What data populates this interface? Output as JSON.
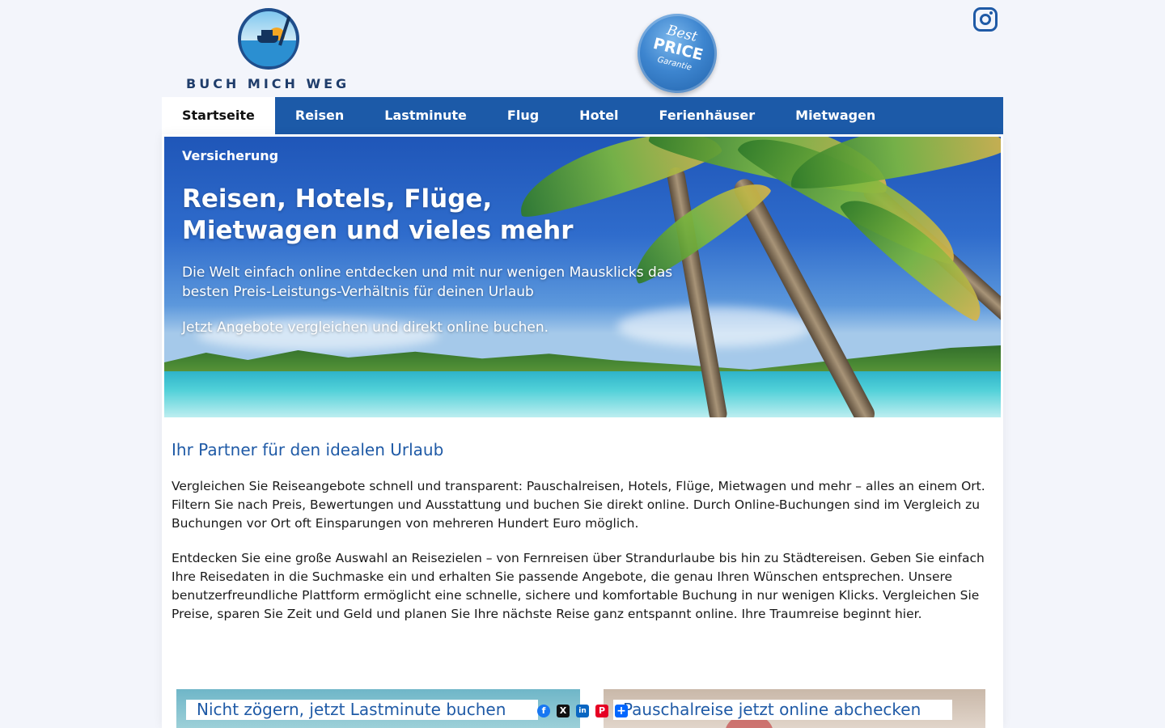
{
  "brand": {
    "logo_text": "BUCH MICH WEG",
    "badge": {
      "line1": "Best",
      "line2": "PRICE",
      "line3": "Garantie"
    },
    "primary_color": "#1c5aa8",
    "link_color": "#1f5aa6"
  },
  "header": {
    "social_icon": "instagram-icon"
  },
  "nav": {
    "items": [
      {
        "label": "Startseite",
        "active": true
      },
      {
        "label": "Reisen"
      },
      {
        "label": "Lastminute"
      },
      {
        "label": "Flug"
      },
      {
        "label": "Hotel"
      },
      {
        "label": "Ferienhäuser"
      },
      {
        "label": "Mietwagen"
      }
    ],
    "overflow_item": "Versicherung"
  },
  "hero": {
    "title": "Reisen, Hotels, Flüge, Mietwagen und vieles mehr",
    "text1": "Die Welt einfach online entdecken und mit nur wenigen Mausklicks das besten Preis-Leistungs-Verhältnis für deinen Urlaub",
    "text2": "Jetzt Angebote vergleichen und direkt online buchen."
  },
  "intro": {
    "title": "Ihr Partner für den idealen Urlaub",
    "p1": "Vergleichen Sie Reiseangebote schnell und transparent: Pauschalreisen, Hotels, Flüge, Mietwagen und mehr – alles an einem Ort. Filtern Sie nach Preis, Bewertungen und Ausstattung und buchen Sie direkt online. Durch Online-Buchungen sind im Vergleich zu Buchungen vor Ort oft Einsparungen von mehreren Hundert Euro möglich.",
    "p2": "Entdecken Sie eine große Auswahl an Reisezielen – von Fernreisen über Strandurlaube bis hin zu Städtereisen. Geben Sie einfach Ihre Reisedaten in die Suchmaske ein und erhalten Sie passende Angebote, die genau Ihren Wünschen entsprechen. Unsere benutzerfreundliche Plattform ermöglicht eine schnelle, sichere und komfortable Buchung in nur wenigen Klicks. Vergleichen Sie Preise, sparen Sie Zeit und Geld und planen Sie Ihre nächste Reise ganz entspannt online. Ihre Traumreise beginnt hier."
  },
  "cards": {
    "left_label": "Nicht zögern, jetzt Lastminute buchen",
    "right_label": "Pauschalreise jetzt online abchecken"
  },
  "share": {
    "buttons": [
      {
        "icon": "facebook-icon",
        "glyph": "f",
        "color": "#1877f2"
      },
      {
        "icon": "x-icon",
        "glyph": "X",
        "color": "#111111"
      },
      {
        "icon": "linkedin-icon",
        "glyph": "in",
        "color": "#0a66c2"
      },
      {
        "icon": "pinterest-icon",
        "glyph": "P",
        "color": "#e60023"
      },
      {
        "icon": "share-plus-icon",
        "glyph": "+",
        "color": "#0166ff"
      }
    ]
  }
}
